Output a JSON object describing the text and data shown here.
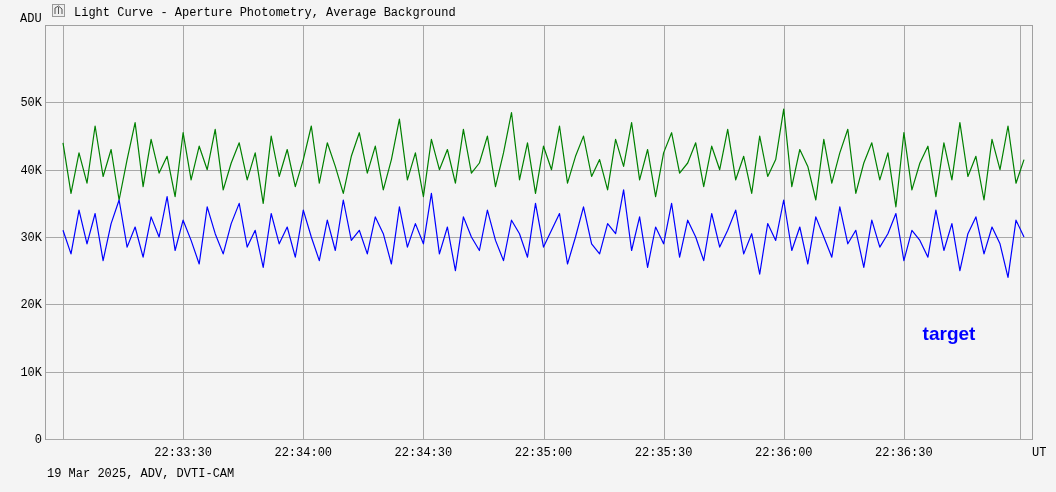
{
  "window": {
    "title": "Light Curve - Aperture Photometry, Average Background"
  },
  "chart": {
    "chart_data": {
      "type": "line",
      "grid": true,
      "ylabel": "ADU",
      "xlabel": "UT",
      "xlim": [
        81175.5,
        81422
      ],
      "ylim": [
        0,
        61500
      ],
      "yticks": [
        {
          "value": 50000,
          "label": "50K"
        },
        {
          "value": 40000,
          "label": "40K"
        },
        {
          "value": 30000,
          "label": "30K"
        },
        {
          "value": 20000,
          "label": "20K"
        },
        {
          "value": 10000,
          "label": "10K"
        },
        {
          "value": 0,
          "label": "0"
        }
      ],
      "xticks": [
        {
          "value": 81210,
          "label": "22:33:30"
        },
        {
          "value": 81240,
          "label": "22:34:00"
        },
        {
          "value": 81270,
          "label": "22:34:30"
        },
        {
          "value": 81300,
          "label": "22:35:00"
        },
        {
          "value": 81330,
          "label": "22:35:30"
        },
        {
          "value": 81360,
          "label": "22:36:00"
        },
        {
          "value": 81390,
          "label": "22:36:30"
        }
      ],
      "x": [
        81180,
        81182,
        81184,
        81186,
        81188,
        81190,
        81192,
        81194,
        81196,
        81198,
        81200,
        81202,
        81204,
        81206,
        81208,
        81210,
        81212,
        81214,
        81216,
        81218,
        81220,
        81222,
        81224,
        81226,
        81228,
        81230,
        81232,
        81234,
        81236,
        81238,
        81240,
        81242,
        81244,
        81246,
        81248,
        81250,
        81252,
        81254,
        81256,
        81258,
        81260,
        81262,
        81264,
        81266,
        81268,
        81270,
        81272,
        81274,
        81276,
        81278,
        81280,
        81282,
        81284,
        81286,
        81288,
        81290,
        81292,
        81294,
        81296,
        81298,
        81300,
        81302,
        81304,
        81306,
        81308,
        81310,
        81312,
        81314,
        81316,
        81318,
        81320,
        81322,
        81324,
        81326,
        81328,
        81330,
        81332,
        81334,
        81336,
        81338,
        81340,
        81342,
        81344,
        81346,
        81348,
        81350,
        81352,
        81354,
        81356,
        81358,
        81360,
        81362,
        81364,
        81366,
        81368,
        81370,
        81372,
        81374,
        81376,
        81378,
        81380,
        81382,
        81384,
        81386,
        81388,
        81390,
        81392,
        81394,
        81396,
        81398,
        81400,
        81402,
        81404,
        81406,
        81408,
        81410,
        81412,
        81414,
        81416,
        81418,
        81420
      ],
      "series": [
        {
          "color": "#008000",
          "values": [
            44000,
            36500,
            42500,
            38000,
            46500,
            39000,
            43000,
            35500,
            41500,
            47000,
            37500,
            44500,
            39500,
            42000,
            36000,
            45500,
            38500,
            43500,
            40000,
            46000,
            37000,
            41000,
            44000,
            38500,
            42500,
            35000,
            45000,
            39000,
            43000,
            37500,
            41500,
            46500,
            38000,
            44000,
            40500,
            36500,
            42000,
            45500,
            39500,
            43500,
            37000,
            41500,
            47500,
            38500,
            42500,
            36000,
            44500,
            40000,
            43000,
            38000,
            46000,
            39500,
            41000,
            45000,
            37500,
            42500,
            48500,
            38500,
            44000,
            36500,
            43500,
            40000,
            46500,
            38000,
            42000,
            45000,
            39000,
            41500,
            37000,
            44500,
            40500,
            47000,
            38500,
            43000,
            36000,
            42500,
            45500,
            39500,
            41000,
            44000,
            37500,
            43500,
            40000,
            46000,
            38500,
            42000,
            36500,
            45000,
            39000,
            41500,
            49000,
            37500,
            43000,
            40500,
            35500,
            44500,
            38000,
            42500,
            46000,
            36500,
            41000,
            44000,
            38500,
            42500,
            34500,
            45500,
            37000,
            41000,
            43500,
            36000,
            44000,
            38500,
            47000,
            39000,
            42000,
            35500,
            44500,
            40000,
            46500,
            38000,
            41500
          ]
        },
        {
          "name": "target",
          "color": "#0000ff",
          "values": [
            31000,
            27500,
            34000,
            29000,
            33500,
            26500,
            32000,
            35500,
            28500,
            31500,
            27000,
            33000,
            30000,
            36000,
            28000,
            32500,
            29500,
            26000,
            34500,
            30500,
            27500,
            32000,
            35000,
            28500,
            31000,
            25500,
            33500,
            29000,
            31500,
            27000,
            34000,
            30000,
            26500,
            32500,
            28000,
            35500,
            29500,
            31000,
            27500,
            33000,
            30500,
            26000,
            34500,
            28500,
            32000,
            29000,
            36500,
            27500,
            31500,
            25000,
            33000,
            30000,
            28000,
            34000,
            29500,
            26500,
            32500,
            30500,
            27000,
            35000,
            28500,
            31000,
            33500,
            26000,
            30000,
            34500,
            29000,
            27500,
            32000,
            30500,
            37000,
            28000,
            33000,
            25500,
            31500,
            29000,
            35000,
            27000,
            32500,
            30000,
            26500,
            33500,
            28500,
            31000,
            34000,
            27500,
            30500,
            24500,
            32000,
            29500,
            35500,
            28000,
            31500,
            26000,
            33000,
            30000,
            27000,
            34500,
            29000,
            31000,
            25500,
            32500,
            28500,
            30500,
            33500,
            26500,
            31000,
            29500,
            27000,
            34000,
            28000,
            32000,
            25000,
            30500,
            33000,
            27500,
            31500,
            29000,
            24000,
            32500,
            30000
          ]
        }
      ]
    }
  },
  "footer": "19 Mar 2025, ADV, DVTI-CAM"
}
